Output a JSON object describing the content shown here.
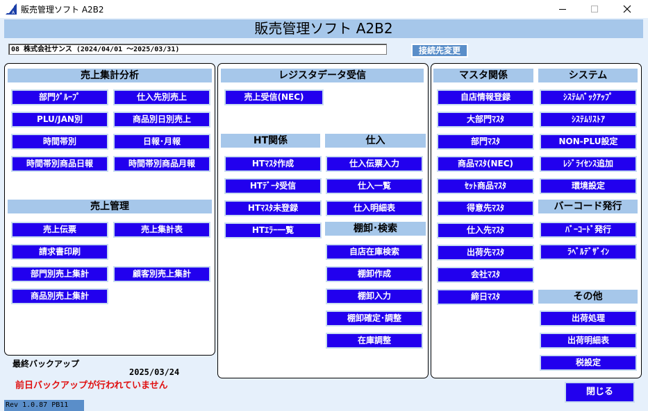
{
  "window": {
    "title": "販売管理ソフト A2B2",
    "icon": "app-logo-icon"
  },
  "banner": {
    "title": "販売管理ソフト A2B2"
  },
  "company": {
    "text": "08 株式会社サンス (2024/04/01 ～2025/03/31)"
  },
  "connection": {
    "switch_label": "接続先変更"
  },
  "sales_analysis": {
    "header": "売上集計分析",
    "buttons": [
      "部門ｸﾞﾙｰﾌﾟ",
      "仕入先別売上",
      "PLU/JAN別",
      "商品別日別売上",
      "時間帯別",
      "日報･月報",
      "時間帯別商品日報",
      "時間帯別商品月報"
    ]
  },
  "sales_mgmt": {
    "header": "売上管理",
    "buttons": [
      "売上伝票",
      "売上集計表",
      "請求書印刷",
      "部門別売上集計",
      "顧客別売上集計",
      "商品別売上集計"
    ]
  },
  "register": {
    "header": "レジスタデータ受信",
    "buttons": [
      "売上受信(NEC)"
    ]
  },
  "ht": {
    "header": "HT関係",
    "buttons": [
      "HTﾏｽﾀ作成",
      "HTﾃﾞｰﾀ受信",
      "HTﾏｽﾀ未登録",
      "HTｴﾗｰ一覧"
    ]
  },
  "purchase": {
    "header": "仕入",
    "buttons": [
      "仕入伝票入力",
      "仕入一覧",
      "仕入明細表"
    ]
  },
  "inventory": {
    "header": "棚卸･検索",
    "buttons": [
      "自店在庫検索",
      "棚卸作成",
      "棚卸入力",
      "棚卸確定･調整",
      "在庫調整"
    ]
  },
  "master": {
    "header": "マスタ関係",
    "buttons": [
      "自店情報登録",
      "大部門ﾏｽﾀ",
      "部門ﾏｽﾀ",
      "商品ﾏｽﾀ(NEC)",
      "ｾｯﾄ商品ﾏｽﾀ",
      "得意先ﾏｽﾀ",
      "仕入先ﾏｽﾀ",
      "出荷先ﾏｽﾀ",
      "会社ﾏｽﾀ",
      "締日ﾏｽﾀ"
    ]
  },
  "system": {
    "header": "システム",
    "buttons": [
      "ｼｽﾃﾑﾊﾞｯｸｱｯﾌﾟ",
      "ｼｽﾃﾑﾘｽﾄｱ",
      "NON-PLU設定",
      "ﾚｼﾞﾗｲｾﾝｽ追加",
      "環境設定"
    ]
  },
  "barcode": {
    "header": "バーコード発行",
    "buttons": [
      "ﾊﾞｰｺｰﾄﾞ発行",
      "ﾗﾍﾞﾙﾃﾞｻﾞｲﾝ"
    ]
  },
  "other": {
    "header": "その他",
    "buttons": [
      "出荷処理",
      "出荷明細表",
      "税設定"
    ]
  },
  "backup": {
    "title": "最終バックアップ",
    "date": "2025/03/24",
    "warning": "前日バックアップが行われていません"
  },
  "footer": {
    "rev": "Rev 1.0.87 PB11",
    "close_label": "閉じる"
  }
}
